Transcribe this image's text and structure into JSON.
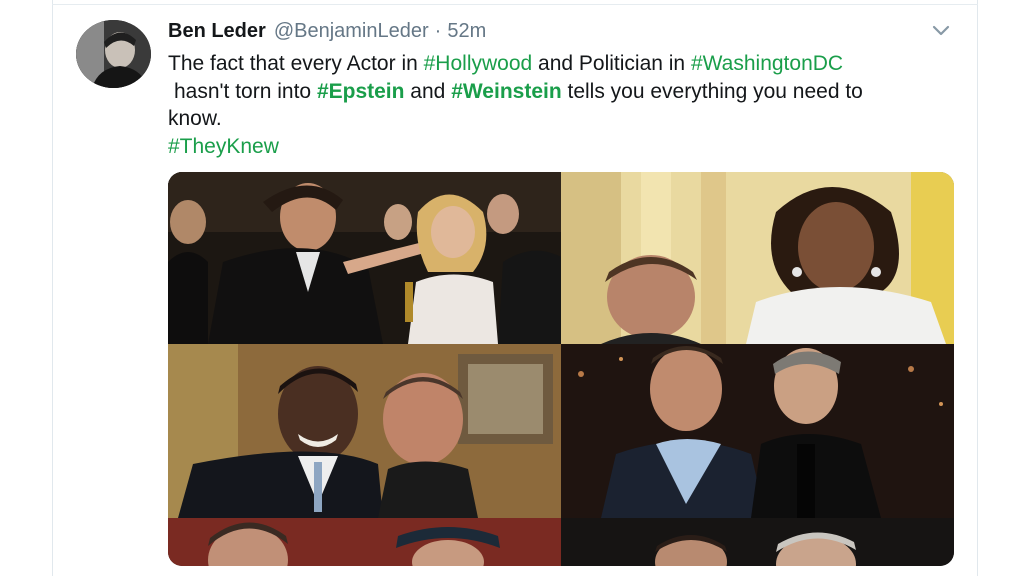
{
  "tweet": {
    "author_name": "Ben Leder",
    "author_handle": "@BenjaminLeder",
    "separator": "·",
    "time": "52m",
    "text": {
      "part1": "The fact that every Actor in ",
      "hashtag1": "#Hollywood",
      "part2": " and Politician in ",
      "hashtag2": "#WashingtonDC",
      "part3": "hasn't torn into ",
      "hashtag3": "#Epstein",
      "part4": " and ",
      "hashtag4": "#Weinstein",
      "part5": " tells you everything you need to",
      "part6": "know.",
      "hashtag5": "#TheyKnew"
    }
  },
  "icons": {
    "avatar": "user-avatar",
    "caret": "chevron-down-icon"
  },
  "colors": {
    "hashtag": "#1a9e4a",
    "text": "#14171a",
    "muted": "#657786"
  },
  "media": {
    "photo_count": 6
  }
}
